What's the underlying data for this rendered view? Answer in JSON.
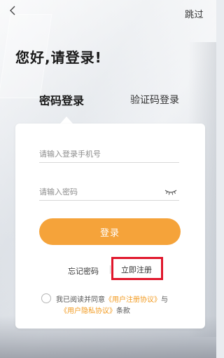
{
  "header": {
    "back_icon": "chevron-left-icon",
    "skip_label": "跳过"
  },
  "greeting": "您好,请登录!",
  "tabs": [
    {
      "label": "密码登录",
      "active": true
    },
    {
      "label": "验证码登录",
      "active": false
    }
  ],
  "form": {
    "phone_placeholder": "请输入登录手机号",
    "phone_value": "",
    "password_placeholder": "请输入密码",
    "password_value": "",
    "eye_icon": "eye-closed-icon",
    "login_label": "登录"
  },
  "links": {
    "forgot_label": "忘记密码",
    "register_label": "立即注册"
  },
  "agreement": {
    "prefix": "我已阅读并同意",
    "user_agreement": "《用户注册协议》",
    "conjunction": "与",
    "privacy_agreement": "《用户隐私协议》",
    "suffix": "条款"
  },
  "colors": {
    "accent": "#f5a33a",
    "link": "#f29b21",
    "highlight_border": "#e0162b"
  }
}
